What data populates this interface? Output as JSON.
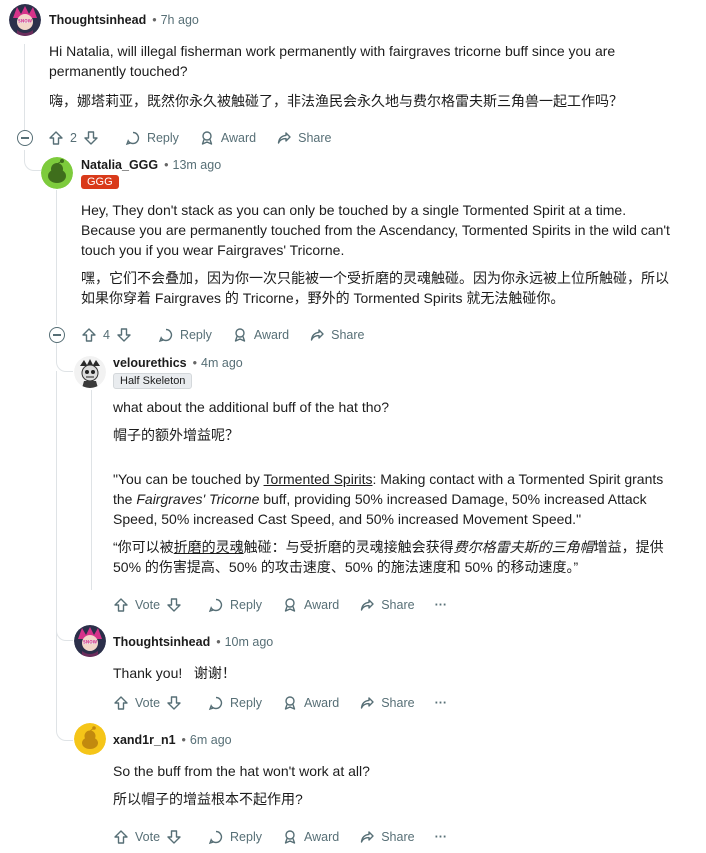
{
  "colors": {
    "accent_flair": "#d93a1a",
    "meta_text": "#576f76",
    "thread_line": "#dfe3e6"
  },
  "comments": [
    {
      "user": "Thoughtsinhead",
      "time": "7h ago",
      "avatar": "pink-hair-avatar",
      "body": [
        "Hi Natalia, will illegal fisherman work permanently with fairgraves tricorne buff since you are",
        "permanently touched?",
        "嗨，娜塔莉亚，既然你永久被触碰了，非法渔民会永久地与费尔格雷夫斯三角兽一起工作吗？"
      ],
      "votes": "2"
    },
    {
      "user": "Natalia_GGG",
      "time": "13m ago",
      "flair": "GGG",
      "avatar": "snoo-green-avatar",
      "body": [
        "Hey, They don't stack as you can only be touched by a single Tormented Spirit at a time.",
        "Because you are permanently touched from the Ascendancy, Tormented Spirits in the wild can't",
        "touch you if you wear Fairgraves' Tricorne.",
        "嘿，它们不会叠加，因为你一次只能被一个受折磨的灵魂触碰。因为你永远被上位所触碰，所以",
        "如果你穿着 Fairgraves 的 Tricorne，野外的 Tormented Spirits 就无法触碰你。"
      ],
      "votes": "4"
    },
    {
      "user": "velourethics",
      "time": "4m ago",
      "flair": "Half Skeleton",
      "avatar": "skeleton-avatar",
      "body": [
        "what about the additional buff of the hat tho?",
        "帽子的额外增益呢？",
        "\"You can be touched by ",
        "Tormented Spirits",
        ": Making contact with a Tormented Spirit grants",
        "the ",
        "Fairgraves' Tricorne",
        " buff, providing 50% increased Damage, 50% increased Attack",
        "Speed, 50% increased Cast Speed, and 50% increased Movement Speed.\"",
        "“你可以被",
        "折磨的灵魂",
        "触碰：与受折磨的灵魂接触会获得",
        "费尔格雷夫斯的三角帽",
        "增益，提供",
        "50% 的伤害提高、50% 的攻击速度、50% 的施法速度和 50% 的移动速度。”"
      ],
      "votes": "Vote"
    },
    {
      "user": "Thoughtsinhead",
      "time": "10m ago",
      "avatar": "pink-hair-avatar",
      "body": [
        "Thank you!   谢谢！"
      ],
      "votes": "Vote"
    },
    {
      "user": "xand1r_n1",
      "time": "6m ago",
      "avatar": "snoo-yellow-avatar",
      "body": [
        "So the buff from the hat won't work at all?",
        "所以帽子的增益根本不起作用?"
      ],
      "votes": "Vote"
    }
  ],
  "actions": {
    "reply": "Reply",
    "award": "Award",
    "share": "Share",
    "more": "···"
  }
}
